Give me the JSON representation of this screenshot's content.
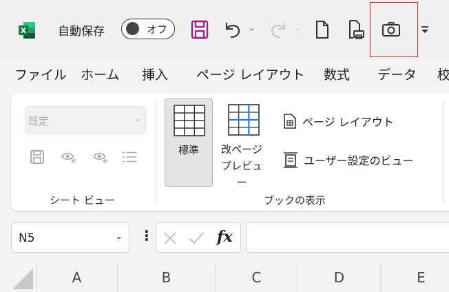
{
  "title_bar": {
    "autosave_label": "自動保存",
    "autosave_toggle": "オフ"
  },
  "quick_access": {
    "icons": [
      "save-icon",
      "undo-icon",
      "redo-icon",
      "new-file-icon",
      "print-preview-icon",
      "camera-icon",
      "customize-qat-icon"
    ]
  },
  "ribbon_tabs": [
    "ファイル",
    "ホーム",
    "挿入",
    "ページ レイアウト",
    "数式",
    "データ",
    "校"
  ],
  "sheet_view": {
    "select_value": "既定",
    "group_label": "シート ビュー"
  },
  "workbook_views": {
    "normal_label": "標準",
    "page_break_label_line1": "改ページ",
    "page_break_label_line2": "プレビュー",
    "page_layout_label": "ページ レイアウト",
    "custom_views_label": "ユーザー設定のビュー",
    "group_label": "ブックの表示"
  },
  "formula_bar": {
    "name_box": "N5",
    "fx_label": "fx"
  },
  "columns": [
    "A",
    "B",
    "C",
    "D",
    "E"
  ],
  "colors": {
    "highlight": "#e02020",
    "excel_green": "#107c41",
    "save_purple": "#9b1c8a"
  }
}
